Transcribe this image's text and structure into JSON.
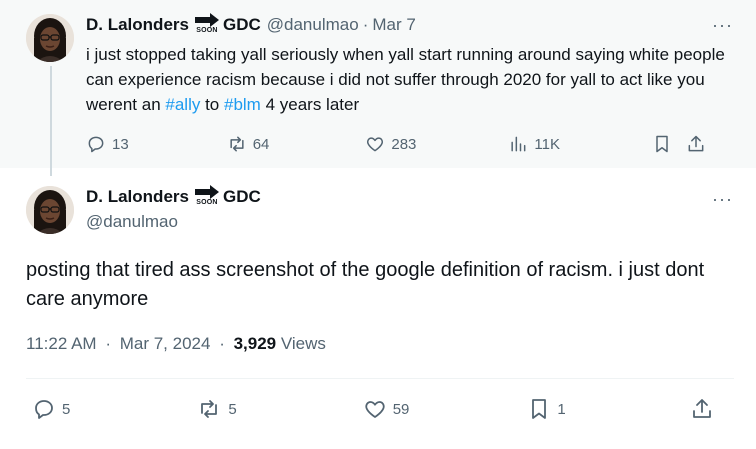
{
  "parent_tweet": {
    "display_name": "D. Lalonders",
    "badge_text": "SOON",
    "name_suffix": "GDC",
    "handle": "@danulmao",
    "separator": "·",
    "date": "Mar 7",
    "text": {
      "part1": "i just stopped taking yall seriously when yall start running around saying white people can experience racism because i did not suffer through 2020 for yall to act like you werent an ",
      "hashtag1": "#ally",
      "part2": " to ",
      "hashtag2": "#blm",
      "part3": " 4 years later"
    },
    "actions": {
      "replies": "13",
      "reposts": "64",
      "likes": "283",
      "views": "11K"
    },
    "more": "···"
  },
  "main_tweet": {
    "display_name": "D. Lalonders",
    "badge_text": "SOON",
    "name_suffix": "GDC",
    "handle": "@danulmao",
    "text": "posting that tired ass screenshot of the google definition of racism. i just dont care anymore",
    "time": "11:22 AM",
    "separator": "·",
    "date": "Mar 7, 2024",
    "views_count": "3,929",
    "views_label": "Views",
    "actions": {
      "replies": "5",
      "reposts": "5",
      "likes": "59",
      "bookmarks": "1"
    },
    "more": "···"
  },
  "colors": {
    "text_primary": "#0f1419",
    "text_secondary": "#536471",
    "link": "#1d9bf0",
    "parent_background": "#f7f9f9",
    "divider": "#eff3f4"
  }
}
